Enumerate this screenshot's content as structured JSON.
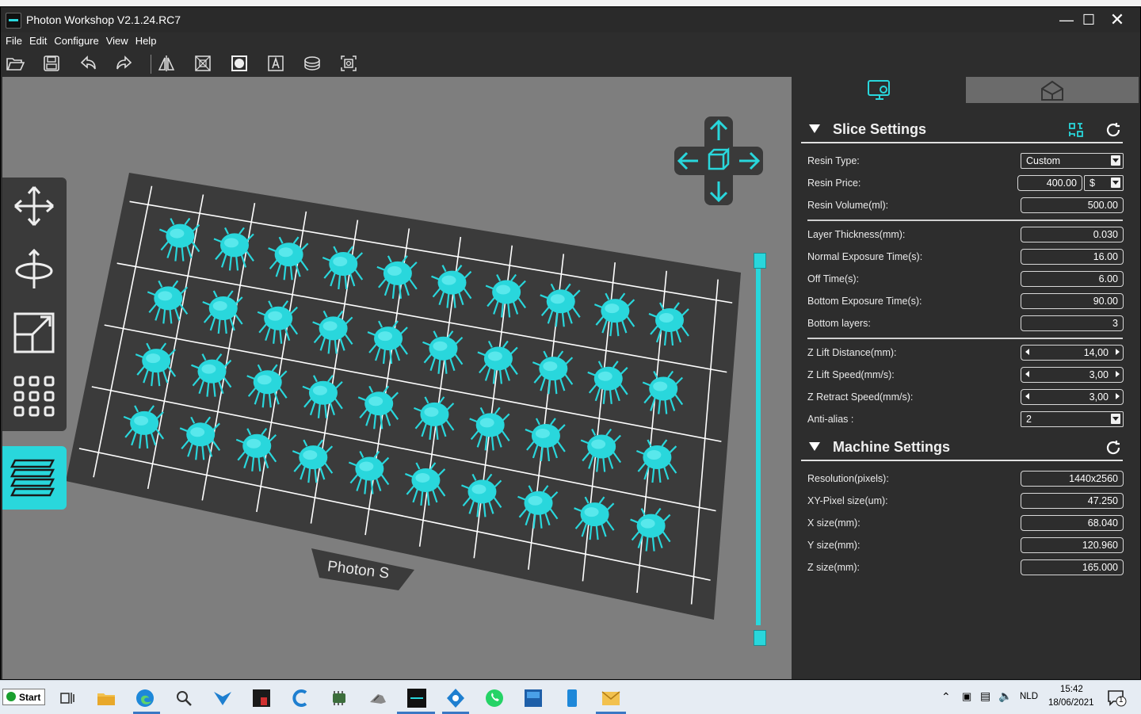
{
  "app": {
    "title": "Photon Workshop V2.1.24.RC7"
  },
  "menu": [
    "File",
    "Edit",
    "Configure",
    "View",
    "Help"
  ],
  "viewport": {
    "plate_label": "Photon S"
  },
  "slice_settings": {
    "title": "Slice Settings",
    "resin_type": {
      "label": "Resin Type:",
      "value": "Custom"
    },
    "resin_price": {
      "label": "Resin Price:",
      "value": "400.00",
      "currency": "$"
    },
    "resin_volume": {
      "label": "Resin Volume(ml):",
      "value": "500.00"
    },
    "layer_thickness": {
      "label": "Layer Thickness(mm):",
      "value": "0.030"
    },
    "normal_exposure": {
      "label": "Normal Exposure Time(s):",
      "value": "16.00"
    },
    "off_time": {
      "label": "Off Time(s):",
      "value": "6.00"
    },
    "bottom_exposure": {
      "label": "Bottom Exposure Time(s):",
      "value": "90.00"
    },
    "bottom_layers": {
      "label": "Bottom layers:",
      "value": "3"
    },
    "z_lift_distance": {
      "label": "Z Lift Distance(mm):",
      "value": "14,00"
    },
    "z_lift_speed": {
      "label": "Z Lift Speed(mm/s):",
      "value": "3,00"
    },
    "z_retract_speed": {
      "label": "Z Retract Speed(mm/s):",
      "value": "3,00"
    },
    "anti_alias": {
      "label": "Anti-alias :",
      "value": "2"
    }
  },
  "machine_settings": {
    "title": "Machine Settings",
    "resolution": {
      "label": "Resolution(pixels):",
      "value": "1440x2560"
    },
    "xy_pixel": {
      "label": "XY-Pixel size(um):",
      "value": "47.250"
    },
    "x_size": {
      "label": "X size(mm):",
      "value": "68.040"
    },
    "y_size": {
      "label": "Y size(mm):",
      "value": "120.960"
    },
    "z_size": {
      "label": "Z size(mm):",
      "value": "165.000"
    }
  },
  "taskbar": {
    "start": "Start",
    "language": "NLD",
    "time": "15:42",
    "date": "18/06/2021",
    "notification_count": "1"
  },
  "colors": {
    "accent": "#29d7dc",
    "viewport_bg": "#7e7e7e",
    "plate": "#3b3b3b",
    "panel_bg": "#2d2d2d"
  }
}
